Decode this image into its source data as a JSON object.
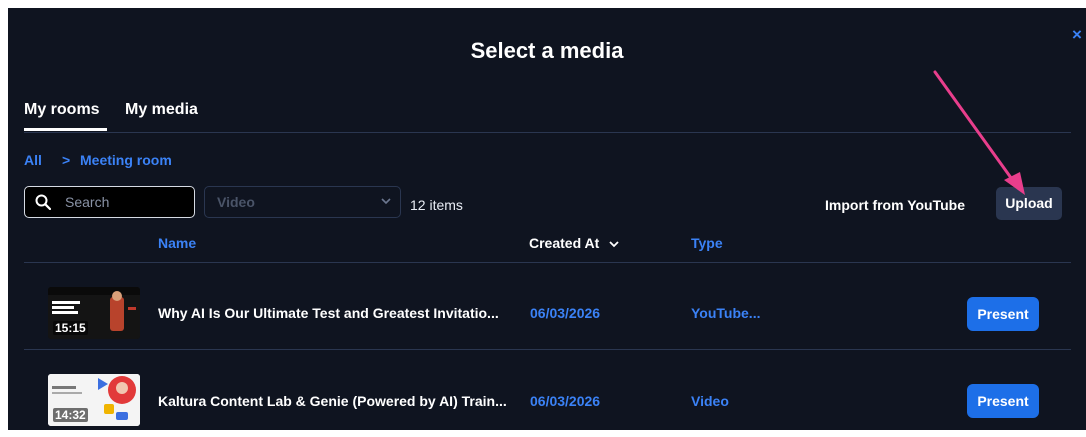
{
  "dialog": {
    "title": "Select a media",
    "close_glyph": "×"
  },
  "tabs": [
    {
      "label": "My rooms",
      "active": true
    },
    {
      "label": "My media",
      "active": false
    }
  ],
  "breadcrumb": {
    "root": "All",
    "separator": ">",
    "current": "Meeting room"
  },
  "toolbar": {
    "search_placeholder": "Search",
    "filter_value": "Video",
    "item_count": "12 items",
    "import_label": "Import from YouTube",
    "upload_label": "Upload"
  },
  "table": {
    "columns": {
      "name": "Name",
      "created": "Created At",
      "type": "Type"
    },
    "rows": [
      {
        "duration": "15:15",
        "name": "Why AI Is Our Ultimate Test and Greatest Invitatio...",
        "created": "06/03/2026",
        "type": "YouTube...",
        "action": "Present"
      },
      {
        "duration": "14:32",
        "name": "Kaltura Content Lab & Genie (Powered by AI) Train...",
        "created": "06/03/2026",
        "type": "Video",
        "action": "Present"
      }
    ]
  },
  "colors": {
    "background": "#0f1420",
    "accent": "#3b82f6",
    "button": "#1d6fe8",
    "annotation_arrow": "#e83e8c"
  },
  "icons": [
    "close-icon",
    "search-icon",
    "chevron-down-icon",
    "sort-chevron-icon",
    "annotation-arrow"
  ]
}
